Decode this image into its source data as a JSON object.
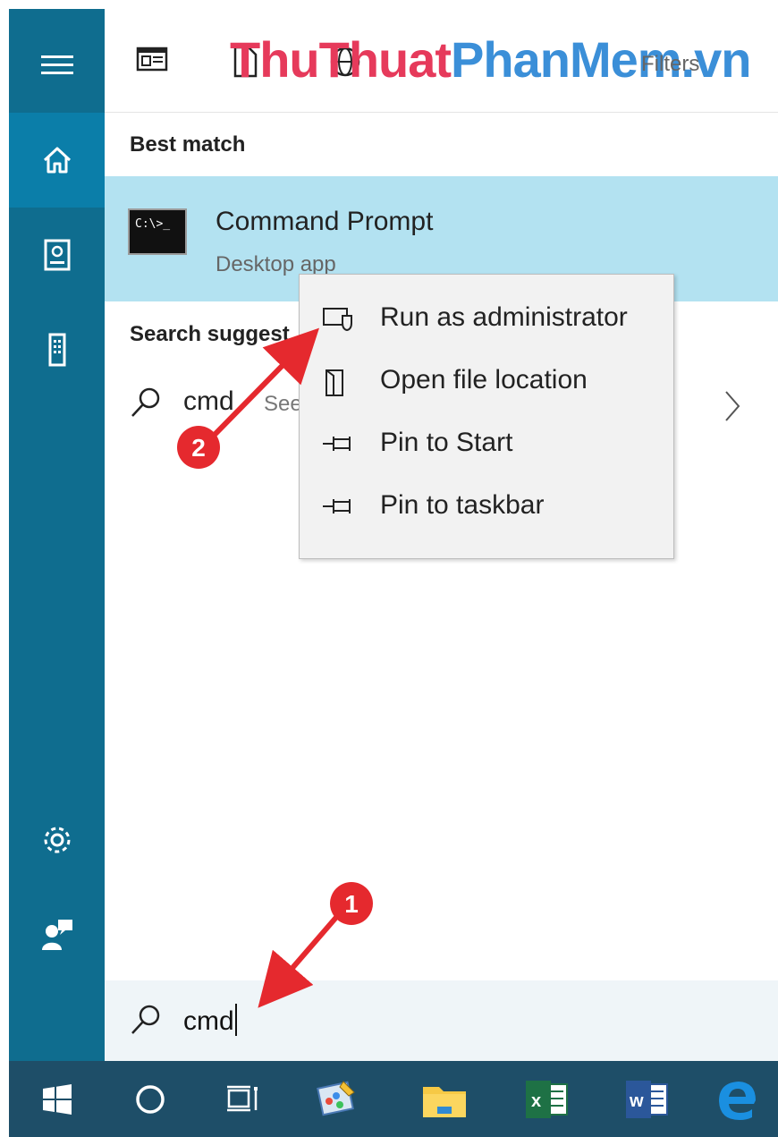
{
  "watermark": {
    "part1": "ThuThuat",
    "part2": "PhanMem",
    "part3": ".vn"
  },
  "header": {
    "filters_label": "Filters"
  },
  "sections": {
    "best_match": "Best match",
    "search_suggestions": "Search suggest"
  },
  "best_match_item": {
    "title": "Command Prompt",
    "subtitle": "Desktop app",
    "icon_text": "C:\\>_"
  },
  "suggestion": {
    "query": "cmd",
    "see_text": "See"
  },
  "context_menu": {
    "items": [
      {
        "label": "Run as administrator",
        "icon": "shield-admin-icon"
      },
      {
        "label": "Open file location",
        "icon": "file-location-icon"
      },
      {
        "label": "Pin to Start",
        "icon": "pin-icon"
      },
      {
        "label": "Pin to taskbar",
        "icon": "pin-icon"
      }
    ]
  },
  "search_box": {
    "value": "cmd"
  },
  "annotations": {
    "badge1": "1",
    "badge2": "2"
  },
  "colors": {
    "rail": "#0f6d8f",
    "rail_active": "#0b7ea9",
    "highlight": "#b3e2f1",
    "taskbar": "#1e4e68",
    "annotation_red": "#e5292e"
  }
}
